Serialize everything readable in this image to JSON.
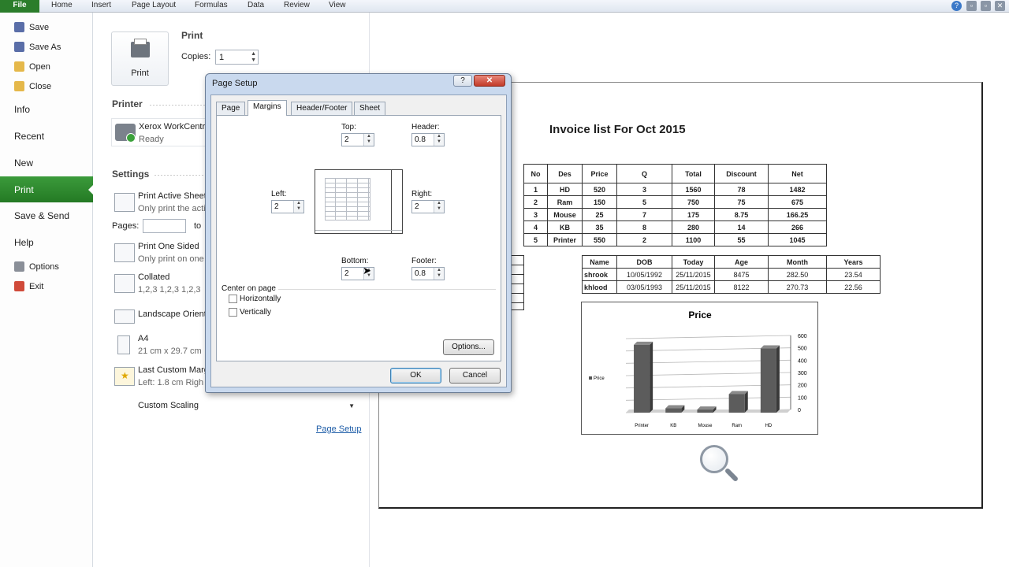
{
  "ribbon": {
    "file": "File",
    "tabs": [
      "Home",
      "Insert",
      "Page Layout",
      "Formulas",
      "Data",
      "Review",
      "View"
    ]
  },
  "nav": {
    "save": "Save",
    "save_as": "Save As",
    "open": "Open",
    "close": "Close",
    "info": "Info",
    "recent": "Recent",
    "new": "New",
    "print": "Print",
    "save_send": "Save & Send",
    "help": "Help",
    "options": "Options",
    "exit": "Exit"
  },
  "print_panel": {
    "print_button": "Print",
    "section_title": "Print",
    "copies_label": "Copies:",
    "copies_value": "1",
    "printer_header": "Printer",
    "printer_name": "Xerox WorkCentre",
    "printer_status": "Ready",
    "settings_header": "Settings",
    "settings": [
      {
        "title": "Print Active Sheets",
        "sub": "Only print the activ"
      },
      {
        "title": "Print One Sided",
        "sub": "Only print on one"
      },
      {
        "title": "Collated",
        "sub": "1,2,3    1,2,3    1,2,3"
      },
      {
        "title": "Landscape Orientation",
        "sub": ""
      },
      {
        "title": "A4",
        "sub": "21 cm x 29.7 cm"
      },
      {
        "title": "Last Custom Margins",
        "sub": "Left: 1.8 cm    Righ"
      }
    ],
    "pages_label": "Pages:",
    "pages_to": "to",
    "custom_scaling": "Custom Scaling",
    "page_setup_link": "Page Setup"
  },
  "dialog": {
    "title": "Page Setup",
    "help_glyph": "?",
    "close_glyph": "✕",
    "tabs": [
      "Page",
      "Margins",
      "Header/Footer",
      "Sheet"
    ],
    "top_label": "Top:",
    "top_value": "2",
    "header_label": "Header:",
    "header_value": "0.8",
    "left_label": "Left:",
    "left_value": "2",
    "right_label": "Right:",
    "right_value": "2",
    "bottom_label": "Bottom:",
    "bottom_value": "2",
    "footer_label": "Footer:",
    "footer_value": "0.8",
    "center_on_page": "Center on page",
    "horizontally": "Horizontally",
    "vertically": "Vertically",
    "options_btn": "Options...",
    "ok_btn": "OK",
    "cancel_btn": "Cancel"
  },
  "preview": {
    "title": "Invoice list For Oct 2015",
    "invoice_headers": [
      "No",
      "Des",
      "Price",
      "Q",
      "Total",
      "Discount",
      "Net"
    ],
    "invoice_rows": [
      [
        "1",
        "HD",
        "520",
        "3",
        "1560",
        "78",
        "1482"
      ],
      [
        "2",
        "Ram",
        "150",
        "5",
        "750",
        "75",
        "675"
      ],
      [
        "3",
        "Mouse",
        "25",
        "7",
        "175",
        "8.75",
        "166.25"
      ],
      [
        "4",
        "KB",
        "35",
        "8",
        "280",
        "14",
        "266"
      ],
      [
        "5",
        "Printer",
        "550",
        "2",
        "1100",
        "55",
        "1045"
      ]
    ],
    "people_headers": [
      "Name",
      "DOB",
      "Today",
      "Age",
      "Month",
      "Years"
    ],
    "people_rows": [
      [
        "shrook",
        "10/05/1992",
        "25/11/2015",
        "8475",
        "282.50",
        "23.54"
      ],
      [
        "khlood",
        "03/05/1993",
        "25/11/2015",
        "8122",
        "270.73",
        "22.56"
      ]
    ]
  },
  "chart_data": {
    "type": "bar",
    "title": "Price",
    "categories": [
      "Printer",
      "KB",
      "Mouse",
      "Ram",
      "HD"
    ],
    "series": [
      {
        "name": "Price",
        "values": [
          550,
          35,
          25,
          150,
          520
        ]
      }
    ],
    "ylim": [
      0,
      600
    ],
    "yticks": [
      0,
      100,
      200,
      300,
      400,
      500,
      600
    ],
    "legend": "left",
    "grid": true
  }
}
